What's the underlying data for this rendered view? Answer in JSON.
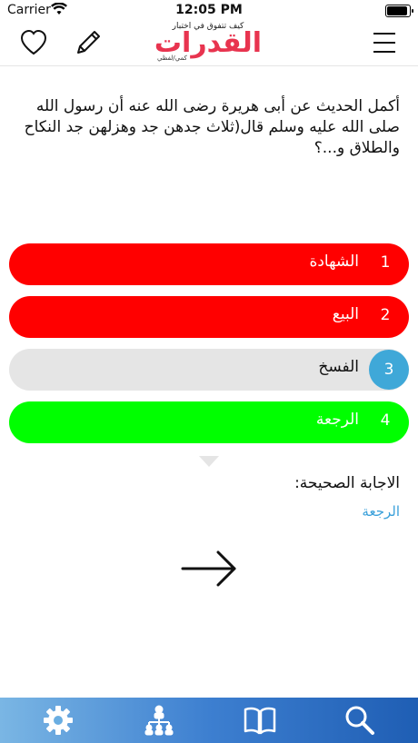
{
  "status_bar": {
    "carrier": "Carrier",
    "time": "12:05 PM"
  },
  "header": {
    "logo_tagline": "كيف تتفوق في اختبار",
    "logo_title": "القدرات",
    "logo_sub": "كمي/لفظي",
    "icons": [
      "heart-icon",
      "pencil-icon",
      "menu-icon"
    ]
  },
  "question": {
    "text": "أكمل الحديث عن أبى هريرة رضى الله عنه أن رسول الله صلى الله عليه وسلم قال(ثلاث جدهن جد وهزلهن جد النكاح والطلاق و...؟"
  },
  "answers": [
    {
      "number": "1",
      "text": "الشهادة",
      "state": "wrong",
      "color": "#ff0000"
    },
    {
      "number": "2",
      "text": "البيع",
      "state": "wrong",
      "color": "#ff0000"
    },
    {
      "number": "3",
      "text": "الفسخ",
      "state": "neutral",
      "color": "#e5e5e5"
    },
    {
      "number": "4",
      "text": "الرجعة",
      "state": "correct",
      "color": "#00ff00"
    }
  ],
  "result": {
    "label": "الاجابة الصحيحة:",
    "answer": "الرجعة"
  },
  "tabbar": {
    "icons": [
      "settings-icon",
      "hierarchy-icon",
      "book-icon",
      "search-icon"
    ]
  },
  "colors": {
    "accent": "#3aa0da",
    "brand": "#e8344f"
  }
}
